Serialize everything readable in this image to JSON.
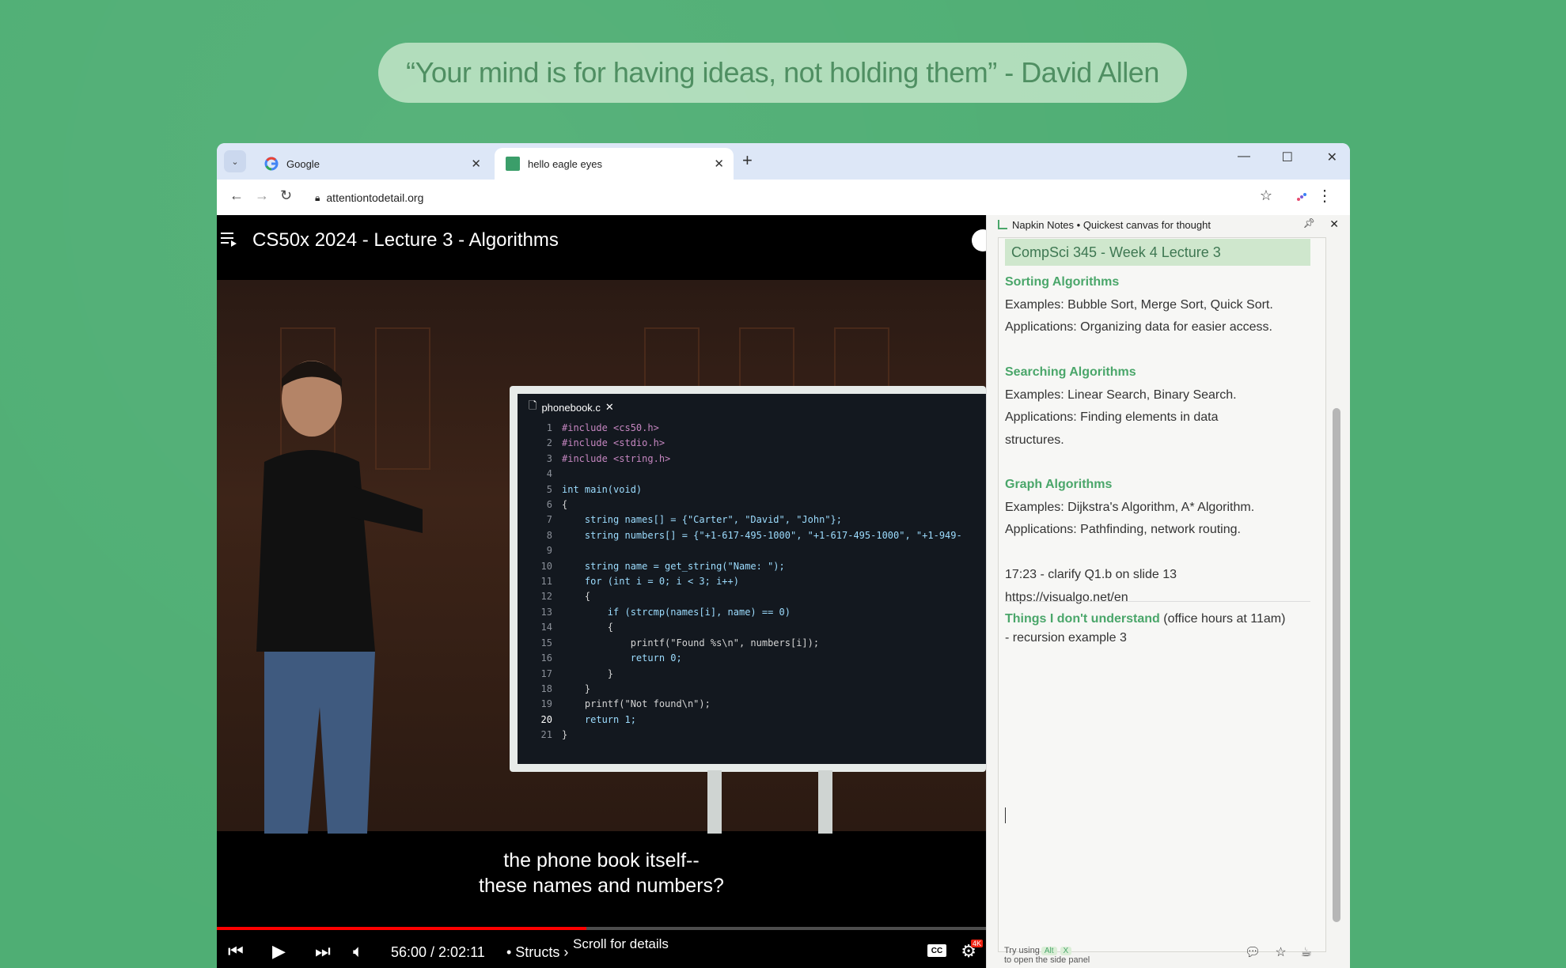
{
  "quote": "“Your mind is for having ideas, not holding them” - David Allen",
  "browser": {
    "tabs": [
      {
        "title": "Google",
        "favicon": "google-icon"
      },
      {
        "title": "hello eagle eyes",
        "favicon": "green-square-icon"
      }
    ],
    "url": "attentiontodetail.org"
  },
  "video": {
    "title": "CS50x 2024 - Lecture 3 - Algorithms",
    "caption_line1": "the phone book itself--",
    "caption_line2": "these names and numbers?",
    "time": "56:00 / 2:02:11",
    "chapter": "• Structs ›",
    "scroll_hint": "Scroll for details",
    "progress": 0.48,
    "badge": "4K",
    "code_file": "phonebook.c",
    "code_lines": [
      "#include <cs50.h>",
      "#include <stdio.h>",
      "#include <string.h>",
      "",
      "int main(void)",
      "{",
      "    string names[] = {\"Carter\", \"David\", \"John\"};",
      "    string numbers[] = {\"+1-617-495-1000\", \"+1-617-495-1000\", \"+1-949-",
      "",
      "    string name = get_string(\"Name: \");",
      "    for (int i = 0; i < 3; i++)",
      "    {",
      "        if (strcmp(names[i], name) == 0)",
      "        {",
      "            printf(\"Found %s\\n\", numbers[i]);",
      "            return 0;",
      "        }",
      "    }",
      "    printf(\"Not found\\n\");",
      "    return 1;",
      "}"
    ]
  },
  "sidepanel": {
    "title": "Napkin Notes • Quickest canvas for thought",
    "note_heading": "CompSci 345 - Week 4 Lecture 3",
    "sections": [
      {
        "h": "Sorting Algorithms",
        "l1": "Examples: Bubble Sort, Merge Sort, Quick Sort.",
        "l2": "Applications: Organizing data for easier access."
      },
      {
        "h": "Searching Algorithms",
        "l1": "Examples: Linear Search, Binary Search.",
        "l2": "Applications: Finding elements in data",
        "l3": "structures."
      },
      {
        "h": "Graph Algorithms",
        "l1": "Examples: Dijkstra's Algorithm, A* Algorithm.",
        "l2": "Applications: Pathfinding, network routing."
      }
    ],
    "timestamp_note": "17:23 - clarify Q1.b on slide 13",
    "link_note": "https://visualgo.net/en",
    "understand_h": "Things I don't understand",
    "understand_extra": " (office hours at 11am)",
    "understand_item": "- recursion example 3",
    "footer_try": "Try using",
    "footer_alt": "Alt",
    "footer_x": "X",
    "footer_line2": "to open the side panel"
  }
}
